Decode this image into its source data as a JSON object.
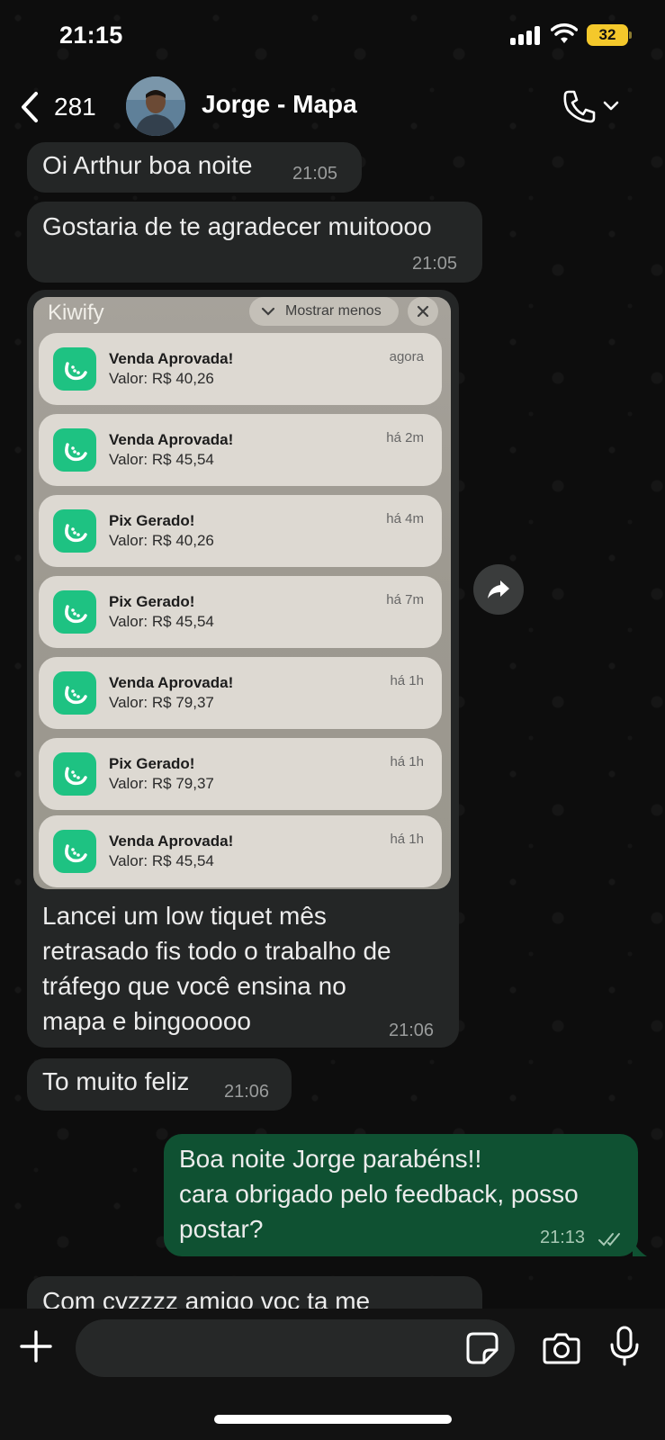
{
  "status_bar": {
    "time": "21:15",
    "battery": "32"
  },
  "header": {
    "back_count": "281",
    "contact_name": "Jorge - Mapa"
  },
  "messages": [
    {
      "text": "Oi Arthur boa noite",
      "time": "21:05"
    },
    {
      "text": "Gostaria de te agradecer muitoooo",
      "time": "21:05"
    },
    {
      "image": {
        "app_name": "Kiwify",
        "show_less_label": "Mostrar menos",
        "notifications": [
          {
            "title": "Venda Aprovada!",
            "value": "Valor: R$ 40,26",
            "time": "agora"
          },
          {
            "title": "Venda Aprovada!",
            "value": "Valor: R$ 45,54",
            "time": "há 2m"
          },
          {
            "title": "Pix Gerado!",
            "value": "Valor: R$ 40,26",
            "time": "há 4m"
          },
          {
            "title": "Pix Gerado!",
            "value": "Valor: R$ 45,54",
            "time": "há 7m"
          },
          {
            "title": "Venda Aprovada!",
            "value": "Valor: R$ 79,37",
            "time": "há 1h"
          },
          {
            "title": "Pix Gerado!",
            "value": "Valor: R$ 79,37",
            "time": "há 1h"
          },
          {
            "title": "Venda Aprovada!",
            "value": "Valor: R$ 45,54",
            "time": "há 1h"
          }
        ]
      },
      "lines": [
        "Lancei um low tiquet mês",
        "retrasado fis todo o trabalho de",
        "tráfego que você ensina no",
        "mapa e bingooooo"
      ],
      "time": "21:06"
    },
    {
      "text": "To muito feliz",
      "time": "21:06"
    },
    {
      "lines": [
        "Boa noite Jorge parabéns!!",
        "cara obrigado pelo feedback, posso",
        "postar?"
      ],
      "time": "21:13"
    },
    {
      "text": "Com cyzzzz amigo voc ta me"
    }
  ],
  "input": {
    "placeholder": ""
  },
  "colors": {
    "incoming_bubble": "#242626",
    "outgoing_bubble": "#0f5132",
    "app_icon": "#1ec282",
    "battery": "#f4c82b"
  }
}
